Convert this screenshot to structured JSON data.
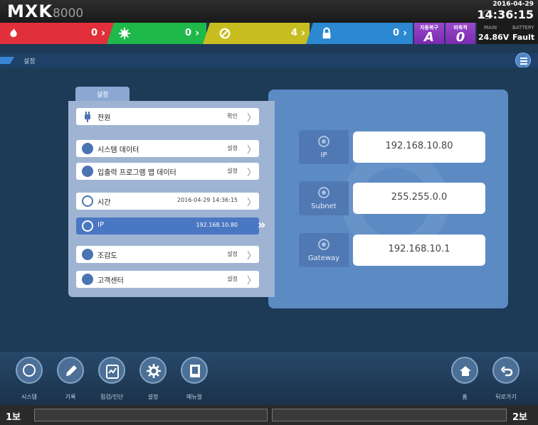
{
  "header": {
    "logo_main": "MXK",
    "logo_num": "8000",
    "date": "2016-04-29",
    "time": "14:36:15"
  },
  "status": [
    {
      "name": "fire",
      "count": "0",
      "color": "#e1303b"
    },
    {
      "name": "fault",
      "count": "0",
      "color": "#1fb84a"
    },
    {
      "name": "supervisory",
      "count": "4",
      "color": "#c7bd1f"
    },
    {
      "name": "lock",
      "count": "0",
      "color": "#2b88d1"
    }
  ],
  "modes": [
    {
      "label": "자동복구",
      "value": "A"
    },
    {
      "label": "비축적",
      "value": "0"
    }
  ],
  "power": {
    "main_label": "MAIN",
    "main_value": "24.86V",
    "battery_label": "BATTERY",
    "battery_value": "Fault"
  },
  "breadcrumb": "설정",
  "settings": {
    "tab": "설정",
    "items": [
      {
        "label": "전원",
        "value": "확인"
      },
      {
        "label": "시스템 데이터",
        "value": "설정"
      },
      {
        "label": "입출력 프로그램 맵 데이터",
        "value": "설정"
      },
      {
        "label": "시간",
        "value": "2016-04-29 14:36:15"
      },
      {
        "label": "IP",
        "value": "192.168.10.80"
      },
      {
        "label": "조감도",
        "value": "설정"
      },
      {
        "label": "고객센터",
        "value": "설정"
      }
    ]
  },
  "network": {
    "ip_label": "IP",
    "ip_value": "192.168.10.80",
    "subnet_label": "Subnet",
    "subnet_value": "255.255.0.0",
    "gateway_label": "Gateway",
    "gateway_value": "192.168.10.1"
  },
  "nav": {
    "system": "시스템",
    "record": "기록",
    "check": "점검/진단",
    "settings": "설정",
    "manual": "매뉴얼",
    "home": "홈",
    "back": "뒤로가기"
  },
  "floors": {
    "left": "1보",
    "right": "2보"
  }
}
